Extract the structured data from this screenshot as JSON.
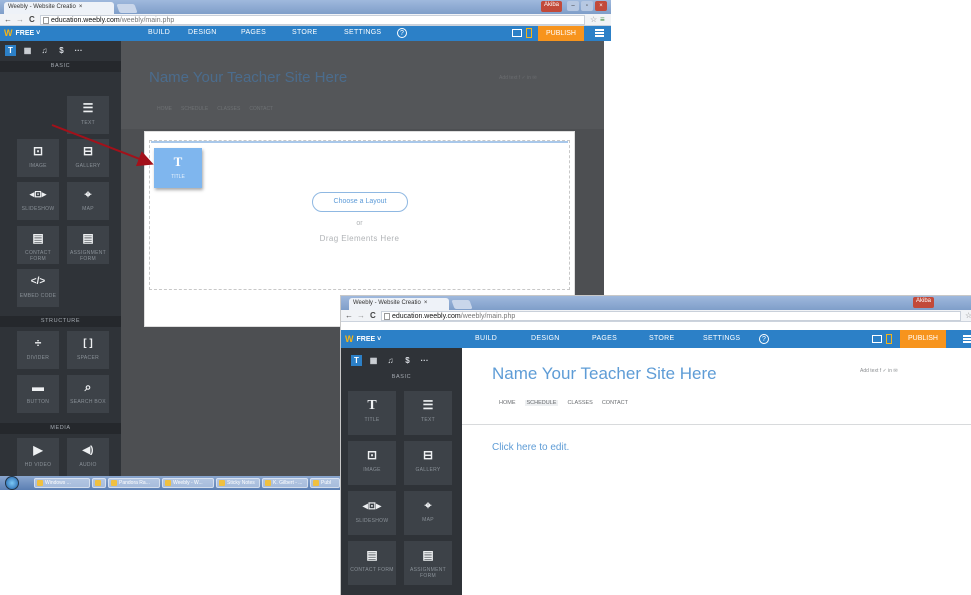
{
  "shot1": {
    "tab_title": "Weebly - Website Creatio",
    "tab_close": "×",
    "user_badge": "Akiba",
    "window_controls": [
      "–",
      "▫",
      "×"
    ],
    "url_host": "education.weebly.com",
    "url_path": "/weebly/main.php",
    "plan_label": "FREE ˅",
    "nav": [
      "BUILD",
      "DESIGN",
      "PAGES",
      "STORE",
      "SETTINGS"
    ],
    "help": "?",
    "publish": "PUBLISH",
    "tool_tabs": [
      "T",
      "▦",
      "♫",
      "$",
      "···"
    ],
    "sections": {
      "basic": "BASIC",
      "structure": "STRUCTURE",
      "media": "MEDIA"
    },
    "tiles_basic": [
      {
        "icon": "",
        "label": ""
      },
      {
        "icon": "☰",
        "label": "TEXT"
      },
      {
        "icon": "⊡",
        "label": "IMAGE"
      },
      {
        "icon": "⊟",
        "label": "GALLERY"
      },
      {
        "icon": "◂⊡▸",
        "label": "SLIDESHOW"
      },
      {
        "icon": "⌖",
        "label": "MAP"
      },
      {
        "icon": "▤",
        "label": "CONTACT FORM"
      },
      {
        "icon": "▤",
        "label": "ASSIGNMENT FORM"
      },
      {
        "icon": "</>",
        "label": "EMBED CODE"
      }
    ],
    "tiles_structure": [
      {
        "icon": "÷",
        "label": "DIVIDER"
      },
      {
        "icon": "[ ]",
        "label": "SPACER"
      },
      {
        "icon": "▬",
        "label": "BUTTON"
      },
      {
        "icon": "⌕",
        "label": "SEARCH BOX"
      }
    ],
    "tiles_media": [
      {
        "icon": "▶",
        "label": "HD VIDEO"
      },
      {
        "icon": "◀)",
        "label": "AUDIO"
      }
    ],
    "site_title": "Name Your Teacher Site Here",
    "add_text": "Add text  f  ✓  in  ✉",
    "site_nav": [
      "HOME",
      "SCHEDULE",
      "CLASSES",
      "CONTACT"
    ],
    "choose_layout": "Choose a Layout",
    "or": "or",
    "drag_here": "Drag Elements Here",
    "drag_tile": {
      "icon": "T",
      "label": "TITLE"
    },
    "taskbar": [
      "Windows ...",
      "",
      "Pandora Ra...",
      "Weebly - W...",
      "Sticky Notes",
      "K. Gilbert - ...",
      "Publ"
    ]
  },
  "shot2": {
    "tab_title": "Weebly - Website Creatio",
    "tab_close": "×",
    "user_badge": "Akiba",
    "url_host": "education.weebly.com",
    "url_path": "/weebly/main.php",
    "plan_label": "FREE ˅",
    "nav": [
      "BUILD",
      "DESIGN",
      "PAGES",
      "STORE",
      "SETTINGS"
    ],
    "help": "?",
    "publish": "PUBLISH",
    "tool_tabs": [
      "T",
      "▦",
      "♫",
      "$",
      "···"
    ],
    "section_basic": "BASIC",
    "tiles": [
      {
        "icon": "T",
        "label": "TITLE"
      },
      {
        "icon": "☰",
        "label": "TEXT"
      },
      {
        "icon": "⊡",
        "label": "IMAGE"
      },
      {
        "icon": "⊟",
        "label": "GALLERY"
      },
      {
        "icon": "◂⊡▸",
        "label": "SLIDESHOW"
      },
      {
        "icon": "⌖",
        "label": "MAP"
      },
      {
        "icon": "▤",
        "label": "CONTACT FORM"
      },
      {
        "icon": "▤",
        "label": "ASSIGNMENT FORM"
      }
    ],
    "site_title": "Name Your Teacher Site Here",
    "add_text": "Add text  f  ✓  in  ✉",
    "site_nav": [
      "HOME",
      "SCHEDULE",
      "CLASSES",
      "CONTACT"
    ],
    "click_edit": "Click here to edit."
  },
  "colors": {
    "weebly_blue": "#2c80c7",
    "publish_orange": "#f7941d",
    "sidebar_dark": "#2f3338",
    "arrow_red": "#a3111a"
  }
}
